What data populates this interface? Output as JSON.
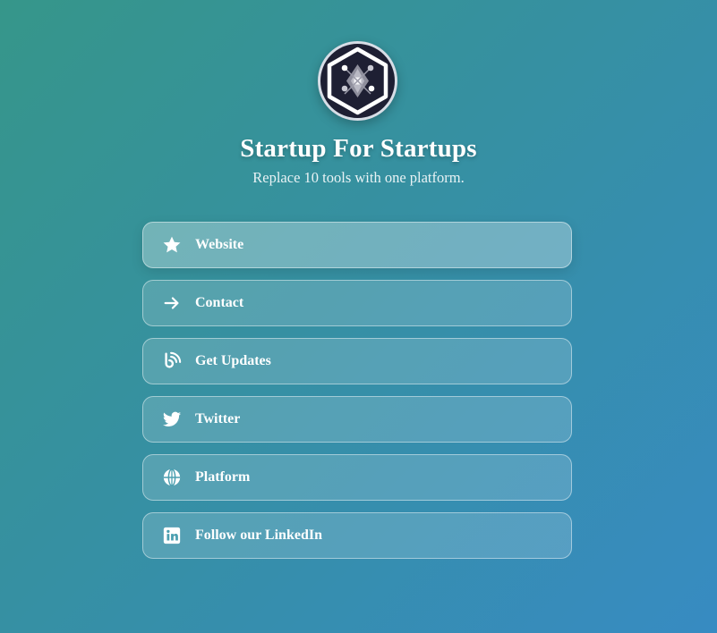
{
  "profile": {
    "title": "Startup For Startups",
    "subtitle": "Replace 10 tools with one platform."
  },
  "links": [
    {
      "label": "Website",
      "icon": "star-icon"
    },
    {
      "label": "Contact",
      "icon": "arrow-right-icon"
    },
    {
      "label": "Get Updates",
      "icon": "rss-feed-icon"
    },
    {
      "label": "Twitter",
      "icon": "twitter-icon"
    },
    {
      "label": "Platform",
      "icon": "globe-icon"
    },
    {
      "label": "Follow our LinkedIn",
      "icon": "linkedin-icon"
    }
  ],
  "colors": {
    "background_start": "#36968a",
    "background_end": "#378bc2",
    "avatar_bg": "#1e1f33",
    "text": "#ffffff"
  }
}
